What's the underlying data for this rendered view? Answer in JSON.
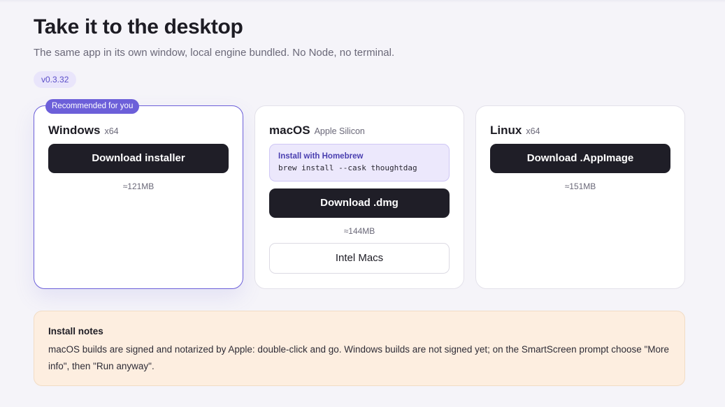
{
  "header": {
    "title": "Take it to the desktop",
    "subtitle": "The same app in its own window, local engine bundled. No Node, no terminal.",
    "version": "v0.3.32"
  },
  "cards": [
    {
      "os": "Windows",
      "arch": "x64",
      "badge": "Recommended for you",
      "button": "Download installer",
      "size": "≈121MB"
    },
    {
      "os": "macOS",
      "arch": "Apple Silicon",
      "homebrew_label": "Install with Homebrew",
      "homebrew_command": "brew install --cask thoughtdag",
      "button": "Download .dmg",
      "size": "≈144MB",
      "secondary_button": "Intel Macs"
    },
    {
      "os": "Linux",
      "arch": "x64",
      "button": "Download .AppImage",
      "size": "≈151MB"
    }
  ],
  "notes": {
    "title": "Install notes",
    "body": "macOS builds are signed and notarized by Apple: double-click and go. Windows builds are not signed yet; on the SmartScreen prompt choose \"More info\", then \"Run anyway\"."
  },
  "colors": {
    "accent": "#6c5fd9",
    "button_dark": "#1f1e27",
    "background": "#f5f4f9",
    "notes_background": "#fdeee0",
    "homebrew_background": "#ece8fc"
  }
}
